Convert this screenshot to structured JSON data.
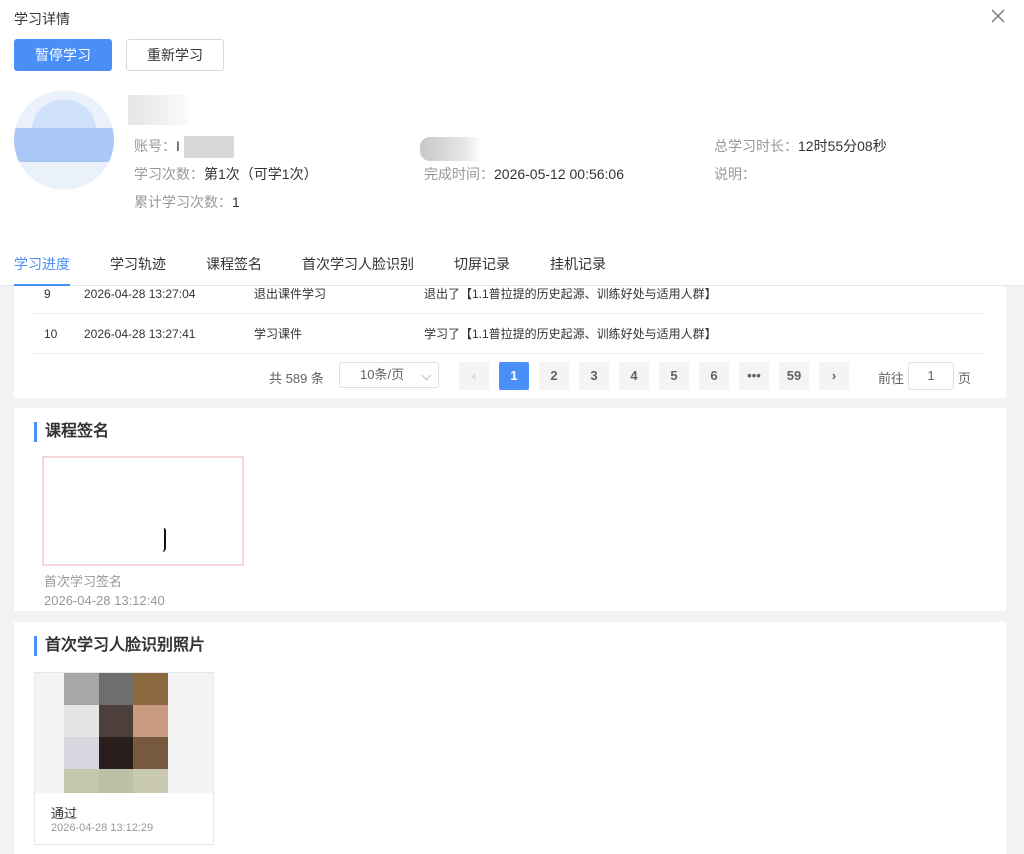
{
  "dialog": {
    "title": "学习详情"
  },
  "actions": {
    "pause": "暂停学习",
    "restart": "重新学习"
  },
  "profile": {
    "account_label": "账号：",
    "account_value": "I",
    "count_label": "学习次数：",
    "count_value": "第1次（可学1次）",
    "total_count_label": "累计学习次数：",
    "total_count_value": "1",
    "finish_label": "完成时间：",
    "finish_value": "2026-05-12 00:56:06",
    "duration_label": "总学习时长：",
    "duration_value": "12时55分08秒",
    "note_label": "说明：",
    "note_value": ""
  },
  "tabs": [
    "学习进度",
    "学习轨迹",
    "课程签名",
    "首次学习人脸识别",
    "切屏记录",
    "挂机记录"
  ],
  "records": [
    {
      "no": "9",
      "time": "2026-04-28 13:27:04",
      "action": "退出课件学习",
      "detail": "退出了【1.1普拉提的历史起源、训练好处与适用人群】"
    },
    {
      "no": "10",
      "time": "2026-04-28 13:27:41",
      "action": "学习课件",
      "detail": "学习了【1.1普拉提的历史起源、训练好处与适用人群】"
    }
  ],
  "pagination": {
    "total": "共 589 条",
    "page_size": "10条/页",
    "pages": [
      "1",
      "2",
      "3",
      "4",
      "5",
      "6",
      "•••",
      "59"
    ],
    "current": "1",
    "goto_label": "前往",
    "goto_value": "1",
    "page_suffix": "页"
  },
  "signature": {
    "title": "课程签名",
    "label": "首次学习签名",
    "time": "2026-04-28 13:12:40"
  },
  "face": {
    "title": "首次学习人脸识别照片",
    "status": "通过",
    "time": "2026-04-28 13:12:29"
  },
  "colors": {
    "primary": "#4a8ef8",
    "border": "#e4e7ed"
  }
}
